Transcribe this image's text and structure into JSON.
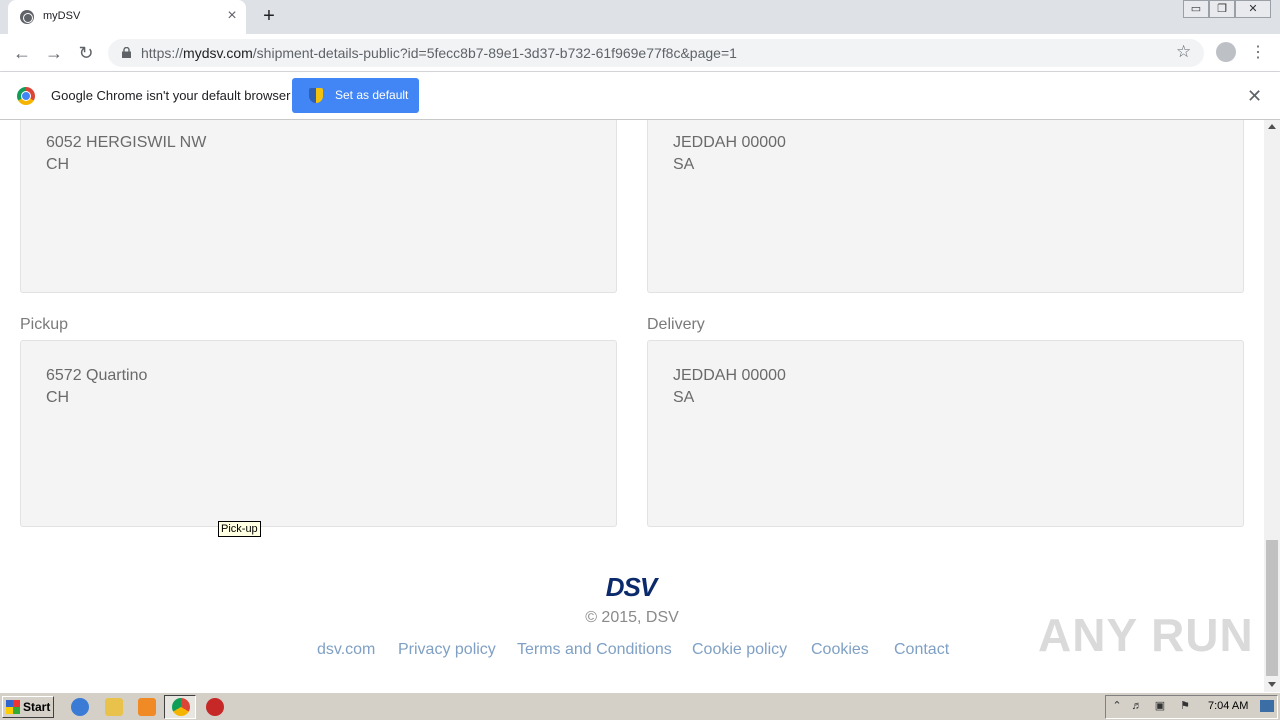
{
  "browser": {
    "tab_title": "myDSV",
    "new_tab": "+",
    "tab_close": "×",
    "url_scheme": "https://",
    "url_host": "mydsv.com",
    "url_path": "/shipment-details-public?id=5fecc8b7-89e1-3d37-b732-61f969e77f8c&page=1",
    "window_controls": [
      "▭",
      "❐",
      "✕"
    ]
  },
  "infobar": {
    "message": "Google Chrome isn't your default browser",
    "button_label": "Set as default",
    "close": "✕"
  },
  "shipment": {
    "top_left": {
      "line1": "6052 HERGISWIL NW",
      "line2": "CH"
    },
    "top_right": {
      "line1": "JEDDAH 00000",
      "line2": "SA"
    },
    "pickup": {
      "label": "Pickup",
      "line1": "6572 Quartino",
      "line2": "CH"
    },
    "delivery": {
      "label": "Delivery",
      "line1": "JEDDAH 00000",
      "line2": "SA"
    }
  },
  "tooltip": "Pick-up",
  "footer": {
    "logo": "DSV",
    "copyright": "© 2015, DSV",
    "links": [
      "dsv.com",
      "Privacy policy",
      "Terms and Conditions",
      "Cookie policy",
      "Cookies",
      "Contact"
    ]
  },
  "watermark": "ANY RUN",
  "taskbar": {
    "start": "Start",
    "clock": "7:04 AM"
  },
  "colors": {
    "accent": "#4285f4",
    "link": "#7fa0c4",
    "dsv_navy": "#0b2a6b",
    "box_bg": "#f4f4f4"
  }
}
